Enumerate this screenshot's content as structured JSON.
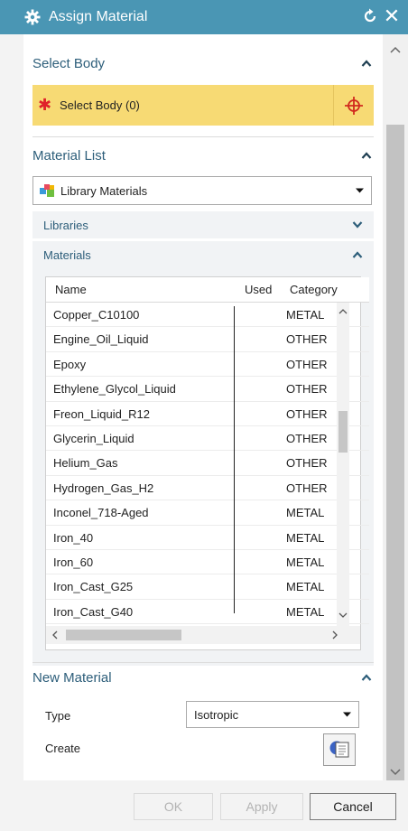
{
  "window": {
    "title": "Assign Material",
    "gear_icon": "gear-icon",
    "reset_icon": "reset-icon",
    "close_icon": "close-icon"
  },
  "select_body": {
    "header": "Select Body",
    "row_label": "Select Body (0)",
    "required_marker": "✱",
    "colors": {
      "highlight": "#f7da74",
      "required": "#e0222a",
      "target": "#d12a1e"
    }
  },
  "material_list": {
    "header": "Material List",
    "source_dropdown": {
      "selected": "Library Materials"
    },
    "libraries_header": "Libraries",
    "materials_header": "Materials",
    "columns": [
      "Name",
      "Used",
      "Category"
    ],
    "rows": [
      {
        "name": "Copper_C10100",
        "used": "",
        "category": "METAL"
      },
      {
        "name": "Engine_Oil_Liquid",
        "used": "",
        "category": "OTHER"
      },
      {
        "name": "Epoxy",
        "used": "",
        "category": "OTHER"
      },
      {
        "name": "Ethylene_Glycol_Liquid",
        "used": "",
        "category": "OTHER"
      },
      {
        "name": "Freon_Liquid_R12",
        "used": "",
        "category": "OTHER"
      },
      {
        "name": "Glycerin_Liquid",
        "used": "",
        "category": "OTHER"
      },
      {
        "name": "Helium_Gas",
        "used": "",
        "category": "OTHER"
      },
      {
        "name": "Hydrogen_Gas_H2",
        "used": "",
        "category": "OTHER"
      },
      {
        "name": "Inconel_718-Aged",
        "used": "",
        "category": "METAL"
      },
      {
        "name": "Iron_40",
        "used": "",
        "category": "METAL"
      },
      {
        "name": "Iron_60",
        "used": "",
        "category": "METAL"
      },
      {
        "name": "Iron_Cast_G25",
        "used": "",
        "category": "METAL"
      },
      {
        "name": "Iron_Cast_G40",
        "used": "",
        "category": "METAL"
      }
    ]
  },
  "new_material": {
    "header": "New Material",
    "type_label": "Type",
    "type_value": "Isotropic",
    "create_label": "Create"
  },
  "footer": {
    "ok": "OK",
    "apply": "Apply",
    "cancel": "Cancel"
  },
  "theme": {
    "accent": "#4a96b4",
    "section_text": "#2d5e7a"
  }
}
